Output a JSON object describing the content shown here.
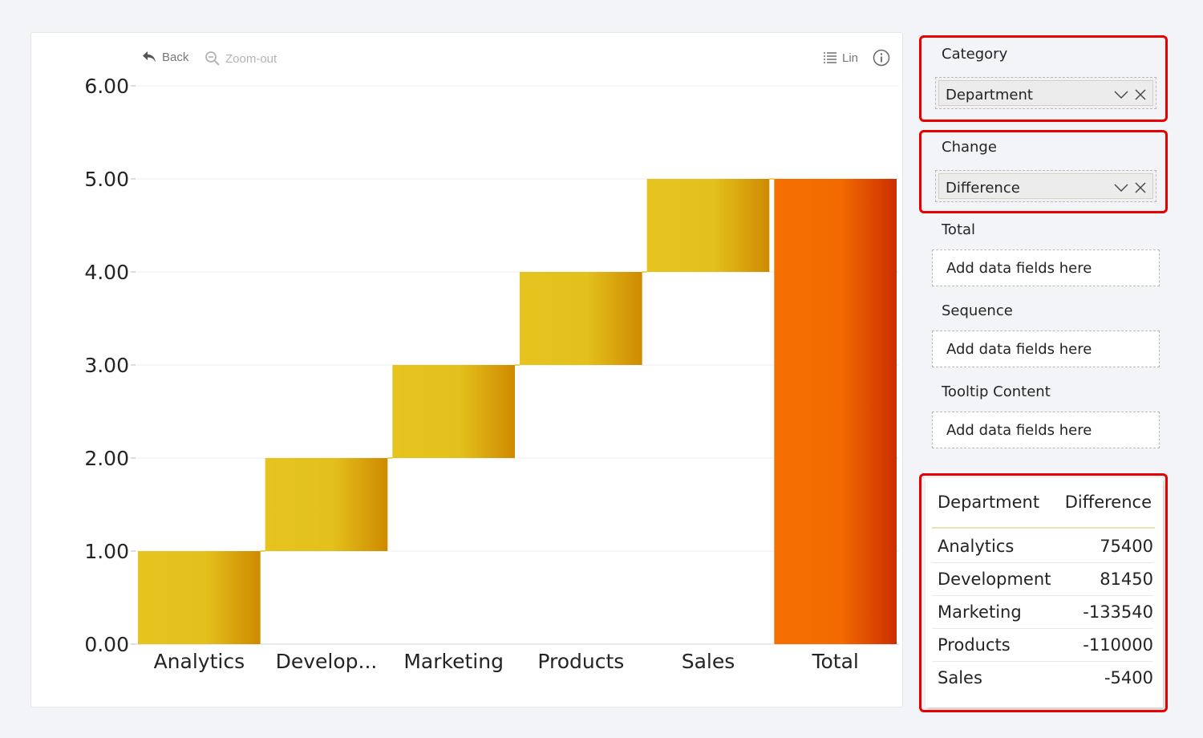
{
  "toolbar": {
    "back_label": "Back",
    "zoomout_label": "Zoom-out",
    "scale_label": "Lin"
  },
  "chart_data": {
    "type": "waterfall",
    "title": "",
    "xlabel": "",
    "ylabel": "",
    "ylim": [
      0,
      6
    ],
    "yticks": [
      "0.00",
      "1.00",
      "2.00",
      "3.00",
      "4.00",
      "5.00",
      "6.00"
    ],
    "grid": true,
    "categories": [
      "Analytics",
      "Develop...",
      "Marketing",
      "Products",
      "Sales",
      "Total"
    ],
    "steps": [
      {
        "category": "Analytics",
        "start": 0,
        "end": 1,
        "kind": "increase"
      },
      {
        "category": "Develop...",
        "start": 1,
        "end": 2,
        "kind": "increase"
      },
      {
        "category": "Marketing",
        "start": 2,
        "end": 3,
        "kind": "increase"
      },
      {
        "category": "Products",
        "start": 3,
        "end": 4,
        "kind": "increase"
      },
      {
        "category": "Sales",
        "start": 4,
        "end": 5,
        "kind": "increase"
      },
      {
        "category": "Total",
        "start": 0,
        "end": 5,
        "kind": "total"
      }
    ],
    "colors": {
      "increase": [
        "#e6c31f",
        "#e3c01c",
        "#cf8a00"
      ],
      "total": [
        "#f57000",
        "#f26a00",
        "#cc2e00"
      ],
      "connector": "#e6c31f"
    }
  },
  "fields_panel": {
    "category": {
      "label": "Category",
      "value": "Department"
    },
    "change": {
      "label": "Change",
      "value": "Difference"
    },
    "total": {
      "label": "Total",
      "placeholder": "Add data fields here"
    },
    "sequence": {
      "label": "Sequence",
      "placeholder": "Add data fields here"
    },
    "tooltip": {
      "label": "Tooltip Content",
      "placeholder": "Add data fields here"
    }
  },
  "table": {
    "headers": [
      "Department",
      "Difference"
    ],
    "header_underline_color": "#e8e3b0",
    "rows": [
      [
        "Analytics",
        "75400"
      ],
      [
        "Development",
        "81450"
      ],
      [
        "Marketing",
        "-133540"
      ],
      [
        "Products",
        "-110000"
      ],
      [
        "Sales",
        "-5400"
      ]
    ]
  },
  "highlight_color": "#e60000"
}
